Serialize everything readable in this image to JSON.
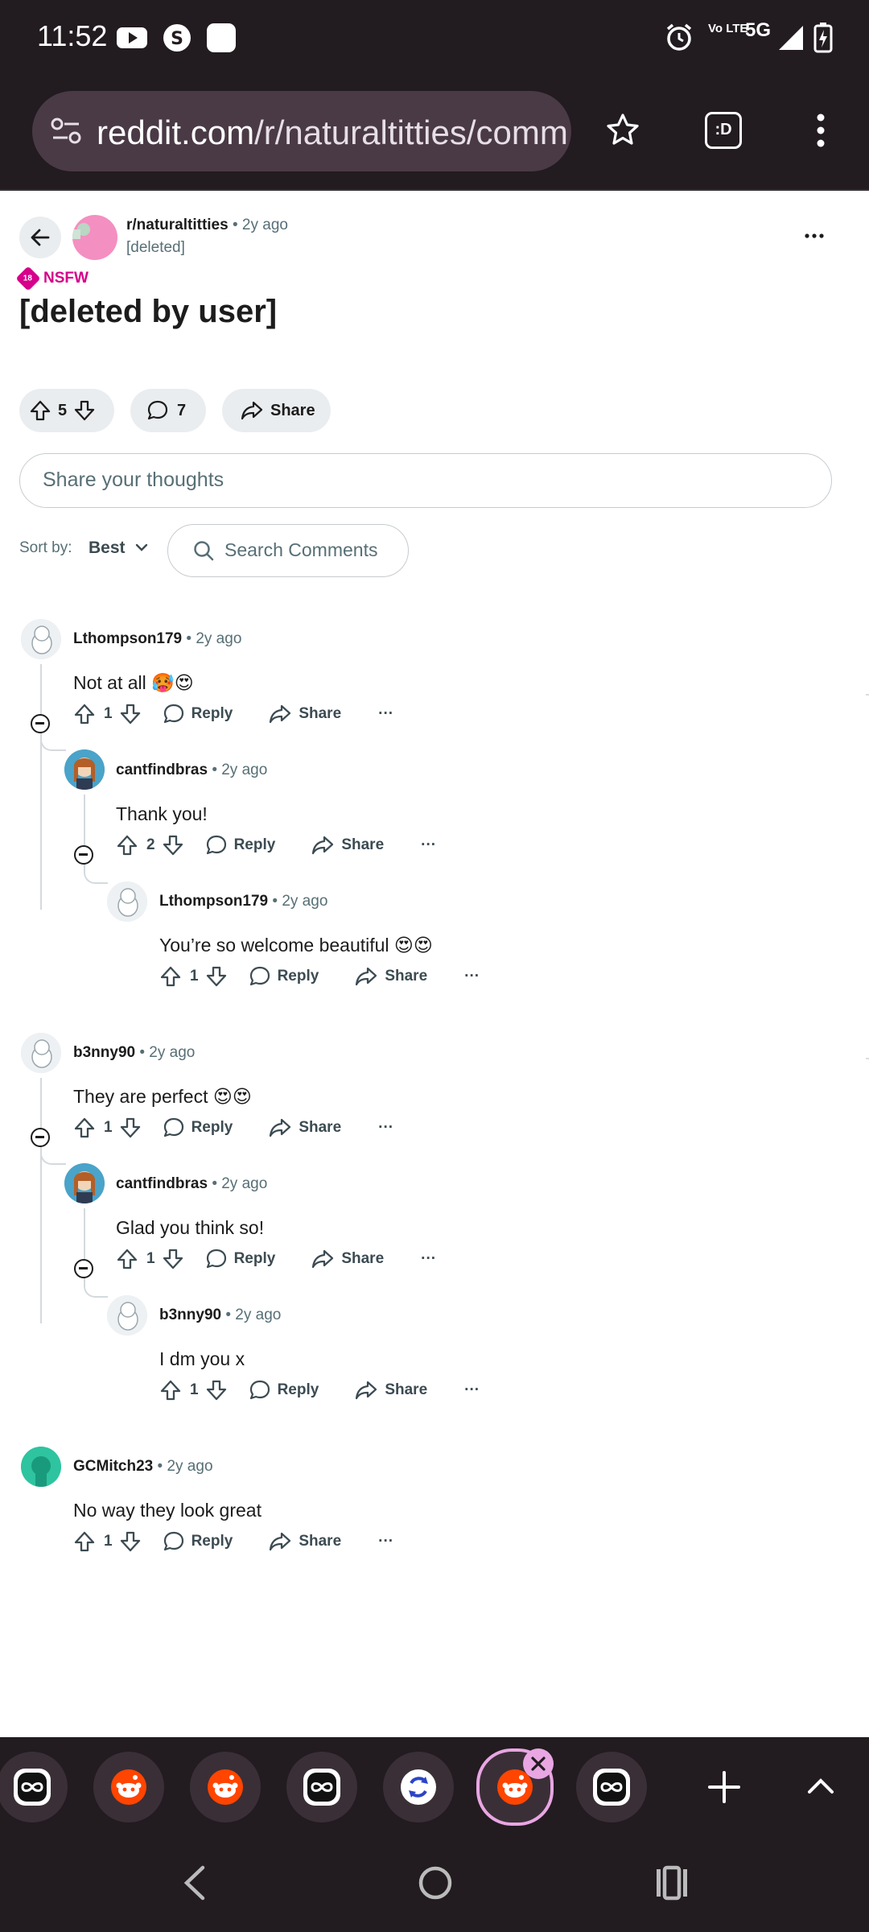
{
  "status_bar": {
    "time": "11:52",
    "network": "5G",
    "volte": "Vo LTE"
  },
  "browser": {
    "url_host": "reddit.com",
    "url_path": "/r/naturaltitties/comm",
    "bookmark_icon": "star-icon",
    "tab_switcher_label": ":D",
    "menu_icon": "kebab-icon"
  },
  "post": {
    "subreddit": "r/naturaltitties",
    "time": "• 2y ago",
    "author": "[deleted]",
    "nsfw_label": "NSFW",
    "nsfw_badge": "18",
    "title": "[deleted by user]",
    "votes": "5",
    "comments": "7",
    "share_label": "Share",
    "compose_placeholder": "Share your thoughts",
    "sort_label": "Sort by:",
    "sort_value": "Best",
    "search_placeholder": "Search Comments"
  },
  "comments": [
    {
      "user": "Lthompson179",
      "time": "• 2y ago",
      "body": "Not at all 🥵😍",
      "votes": "1",
      "reply": "Reply",
      "share": "Share",
      "more": "···"
    },
    {
      "user": "cantfindbras",
      "time": "• 2y ago",
      "body": "Thank you!",
      "votes": "2",
      "reply": "Reply",
      "share": "Share",
      "more": "···"
    },
    {
      "user": "Lthompson179",
      "time": "• 2y ago",
      "body": "You’re so welcome beautiful 😍😍",
      "votes": "1",
      "reply": "Reply",
      "share": "Share",
      "more": "···"
    },
    {
      "user": "b3nny90",
      "time": "• 2y ago",
      "body": "They are perfect 😍😍",
      "votes": "1",
      "reply": "Reply",
      "share": "Share",
      "more": "···"
    },
    {
      "user": "cantfindbras",
      "time": "• 2y ago",
      "body": "Glad you think so!",
      "votes": "1",
      "reply": "Reply",
      "share": "Share",
      "more": "···"
    },
    {
      "user": "b3nny90",
      "time": "• 2y ago",
      "body": "I dm you x",
      "votes": "1",
      "reply": "Reply",
      "share": "Share",
      "more": "···"
    },
    {
      "user": "GCMitch23",
      "time": "• 2y ago",
      "body": "No way they look great",
      "votes": "1",
      "reply": "Reply",
      "share": "Share",
      "more": "···"
    }
  ],
  "tab_strip": {
    "tabs": [
      "infinity-app-icon",
      "reddit-icon",
      "reddit-icon",
      "infinity-app-icon",
      "refresh-app-icon",
      "reddit-icon",
      "infinity-app-icon"
    ],
    "active_index": 5,
    "new_tab_icon": "plus-icon",
    "expand_icon": "chevron-up-icon"
  },
  "colors": {
    "chrome": "#221b20",
    "accent_nsfw": "#d6008b",
    "active_tab_ring": "#e9a6e3"
  }
}
